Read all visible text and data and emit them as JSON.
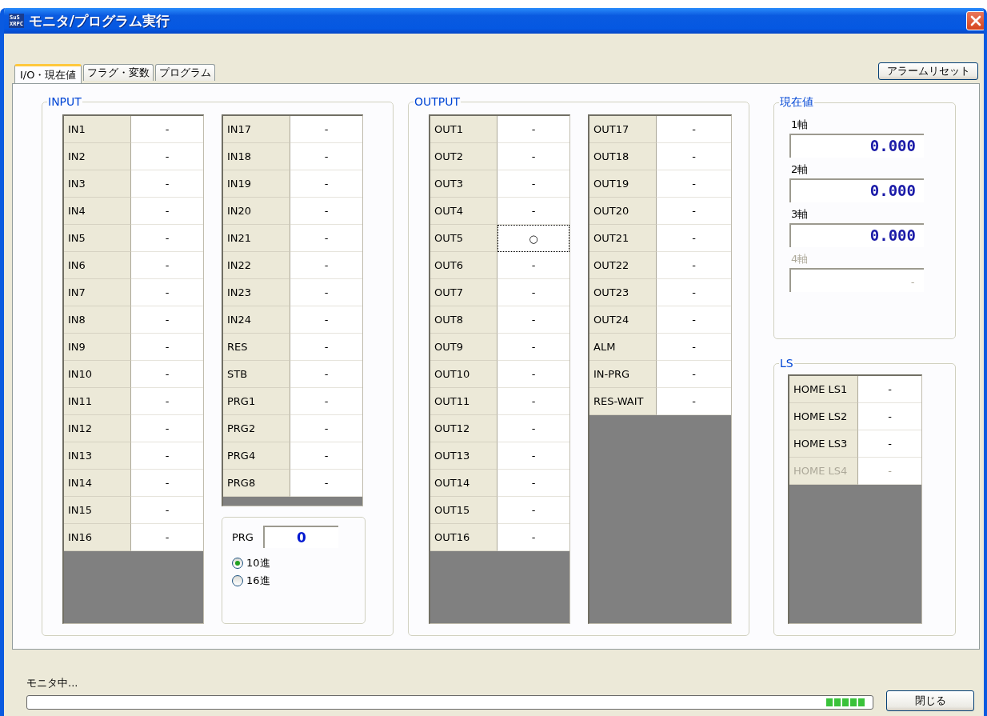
{
  "window": {
    "title": "モニタ/プログラム実行",
    "logo": [
      "SuS",
      "XRPC"
    ]
  },
  "tabs": [
    {
      "label": "I/O・現在値",
      "selected": true
    },
    {
      "label": "フラグ・変数",
      "selected": false
    },
    {
      "label": "プログラム",
      "selected": false
    }
  ],
  "alarm_reset_button": "アラームリセット",
  "input": {
    "title": "INPUT",
    "tables": [
      {
        "rows": [
          {
            "label": "IN1",
            "value": "-",
            "disabled": false,
            "focused": false
          },
          {
            "label": "IN2",
            "value": "-",
            "disabled": false,
            "focused": false
          },
          {
            "label": "IN3",
            "value": "-",
            "disabled": false,
            "focused": false
          },
          {
            "label": "IN4",
            "value": "-",
            "disabled": false,
            "focused": false
          },
          {
            "label": "IN5",
            "value": "-",
            "disabled": false,
            "focused": false
          },
          {
            "label": "IN6",
            "value": "-",
            "disabled": false,
            "focused": false
          },
          {
            "label": "IN7",
            "value": "-",
            "disabled": false,
            "focused": false
          },
          {
            "label": "IN8",
            "value": "-",
            "disabled": false,
            "focused": false
          },
          {
            "label": "IN9",
            "value": "-",
            "disabled": false,
            "focused": false
          },
          {
            "label": "IN10",
            "value": "-",
            "disabled": false,
            "focused": false
          },
          {
            "label": "IN11",
            "value": "-",
            "disabled": false,
            "focused": false
          },
          {
            "label": "IN12",
            "value": "-",
            "disabled": false,
            "focused": false
          },
          {
            "label": "IN13",
            "value": "-",
            "disabled": false,
            "focused": false
          },
          {
            "label": "IN14",
            "value": "-",
            "disabled": false,
            "focused": false
          },
          {
            "label": "IN15",
            "value": "-",
            "disabled": false,
            "focused": false
          },
          {
            "label": "IN16",
            "value": "-",
            "disabled": false,
            "focused": false
          }
        ]
      },
      {
        "rows": [
          {
            "label": "IN17",
            "value": "-",
            "disabled": false,
            "focused": false
          },
          {
            "label": "IN18",
            "value": "-",
            "disabled": false,
            "focused": false
          },
          {
            "label": "IN19",
            "value": "-",
            "disabled": false,
            "focused": false
          },
          {
            "label": "IN20",
            "value": "-",
            "disabled": false,
            "focused": false
          },
          {
            "label": "IN21",
            "value": "-",
            "disabled": false,
            "focused": false
          },
          {
            "label": "IN22",
            "value": "-",
            "disabled": false,
            "focused": false
          },
          {
            "label": "IN23",
            "value": "-",
            "disabled": false,
            "focused": false
          },
          {
            "label": "IN24",
            "value": "-",
            "disabled": false,
            "focused": false
          },
          {
            "label": "RES",
            "value": "-",
            "disabled": false,
            "focused": false
          },
          {
            "label": "STB",
            "value": "-",
            "disabled": false,
            "focused": false
          },
          {
            "label": "PRG1",
            "value": "-",
            "disabled": false,
            "focused": false
          },
          {
            "label": "PRG2",
            "value": "-",
            "disabled": false,
            "focused": false
          },
          {
            "label": "PRG4",
            "value": "-",
            "disabled": false,
            "focused": false
          },
          {
            "label": "PRG8",
            "value": "-",
            "disabled": false,
            "focused": false
          }
        ]
      }
    ],
    "prg": {
      "label": "PRG",
      "value": "0",
      "radios": [
        {
          "label": "10進",
          "selected": true
        },
        {
          "label": "16進",
          "selected": false
        }
      ]
    }
  },
  "output": {
    "title": "OUTPUT",
    "tables": [
      {
        "rows": [
          {
            "label": "OUT1",
            "value": "-",
            "disabled": false,
            "focused": false
          },
          {
            "label": "OUT2",
            "value": "-",
            "disabled": false,
            "focused": false
          },
          {
            "label": "OUT3",
            "value": "-",
            "disabled": false,
            "focused": false
          },
          {
            "label": "OUT4",
            "value": "-",
            "disabled": false,
            "focused": false
          },
          {
            "label": "OUT5",
            "value": "○",
            "disabled": false,
            "focused": true
          },
          {
            "label": "OUT6",
            "value": "-",
            "disabled": false,
            "focused": false
          },
          {
            "label": "OUT7",
            "value": "-",
            "disabled": false,
            "focused": false
          },
          {
            "label": "OUT8",
            "value": "-",
            "disabled": false,
            "focused": false
          },
          {
            "label": "OUT9",
            "value": "-",
            "disabled": false,
            "focused": false
          },
          {
            "label": "OUT10",
            "value": "-",
            "disabled": false,
            "focused": false
          },
          {
            "label": "OUT11",
            "value": "-",
            "disabled": false,
            "focused": false
          },
          {
            "label": "OUT12",
            "value": "-",
            "disabled": false,
            "focused": false
          },
          {
            "label": "OUT13",
            "value": "-",
            "disabled": false,
            "focused": false
          },
          {
            "label": "OUT14",
            "value": "-",
            "disabled": false,
            "focused": false
          },
          {
            "label": "OUT15",
            "value": "-",
            "disabled": false,
            "focused": false
          },
          {
            "label": "OUT16",
            "value": "-",
            "disabled": false,
            "focused": false
          }
        ]
      },
      {
        "rows": [
          {
            "label": "OUT17",
            "value": "-",
            "disabled": false,
            "focused": false
          },
          {
            "label": "OUT18",
            "value": "-",
            "disabled": false,
            "focused": false
          },
          {
            "label": "OUT19",
            "value": "-",
            "disabled": false,
            "focused": false
          },
          {
            "label": "OUT20",
            "value": "-",
            "disabled": false,
            "focused": false
          },
          {
            "label": "OUT21",
            "value": "-",
            "disabled": false,
            "focused": false
          },
          {
            "label": "OUT22",
            "value": "-",
            "disabled": false,
            "focused": false
          },
          {
            "label": "OUT23",
            "value": "-",
            "disabled": false,
            "focused": false
          },
          {
            "label": "OUT24",
            "value": "-",
            "disabled": false,
            "focused": false
          },
          {
            "label": "ALM",
            "value": "-",
            "disabled": false,
            "focused": false
          },
          {
            "label": "IN-PRG",
            "value": "-",
            "disabled": false,
            "focused": false
          },
          {
            "label": "RES-WAIT",
            "value": "-",
            "disabled": false,
            "focused": false
          }
        ]
      }
    ]
  },
  "current_values": {
    "title": "現在値",
    "axes": [
      {
        "label": "1軸",
        "value": "0.000",
        "disabled": false
      },
      {
        "label": "2軸",
        "value": "0.000",
        "disabled": false
      },
      {
        "label": "3軸",
        "value": "0.000",
        "disabled": false
      },
      {
        "label": "4軸",
        "value": "-",
        "disabled": true
      }
    ]
  },
  "ls": {
    "title": "LS",
    "rows": [
      {
        "label": "HOME LS1",
        "value": "-",
        "disabled": false,
        "focused": false
      },
      {
        "label": "HOME LS2",
        "value": "-",
        "disabled": false,
        "focused": false
      },
      {
        "label": "HOME LS3",
        "value": "-",
        "disabled": false,
        "focused": false
      },
      {
        "label": "HOME LS4",
        "value": "-",
        "disabled": true,
        "focused": false
      }
    ]
  },
  "status": "モニタ中...",
  "progress": {
    "on": true
  },
  "close_button": "閉じる"
}
